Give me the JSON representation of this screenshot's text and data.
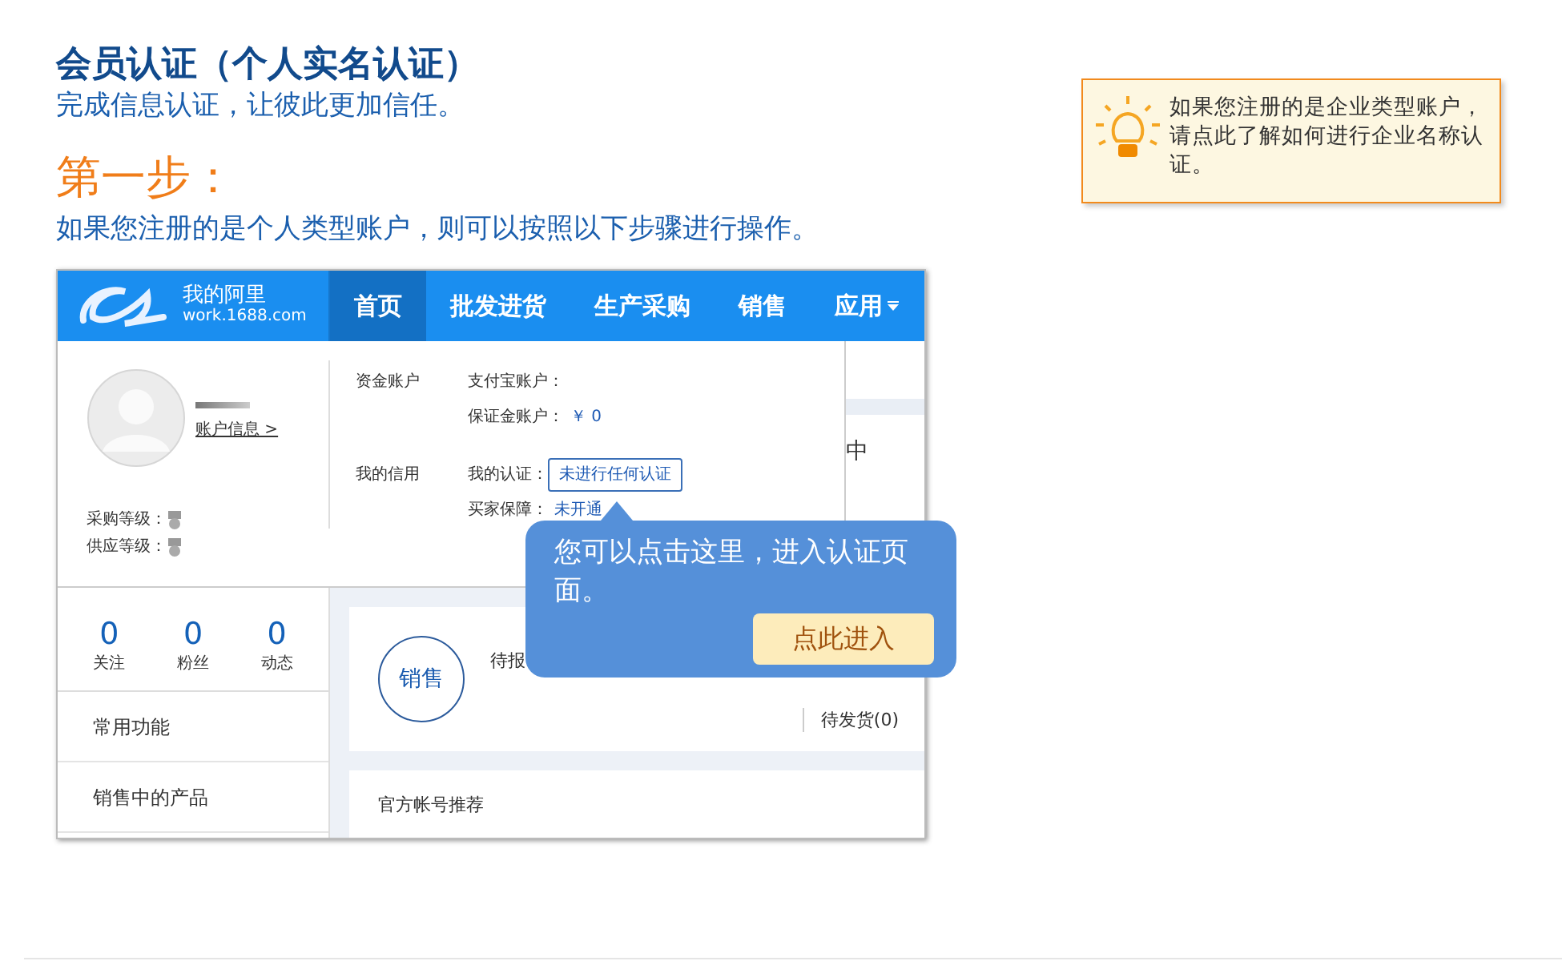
{
  "header": {
    "title": "会员认证（个人实名认证）",
    "subtitle": "完成信息认证，让彼此更加信任。"
  },
  "tip": {
    "text": "如果您注册的是企业类型账户，请点此了解如何进行企业名称认证。"
  },
  "step": {
    "heading": "第一步：",
    "text": "如果您注册的是个人类型账户，则可以按照以下步骤进行操作。"
  },
  "screenshot": {
    "brand": {
      "name": "我的阿里",
      "site": "work.1688.com"
    },
    "nav": [
      {
        "label": "首页",
        "selected": true
      },
      {
        "label": "批发进货",
        "selected": false
      },
      {
        "label": "生产采购",
        "selected": false
      },
      {
        "label": "销售",
        "selected": false
      },
      {
        "label": "应用",
        "selected": false,
        "dropdown": true
      }
    ],
    "profile": {
      "account_link": "账户信息 >",
      "levels": [
        {
          "label": "采购等级："
        },
        {
          "label": "供应等级："
        }
      ]
    },
    "sections": [
      {
        "title": "资金账户",
        "rows": [
          {
            "label": "支付宝账户："
          },
          {
            "label": "保证金账户：",
            "value": "￥ 0"
          }
        ]
      },
      {
        "title": "我的信用",
        "rows": [
          {
            "label": "我的认证：",
            "value": "未进行任何认证",
            "highlighted": true
          },
          {
            "label": "买家保障：",
            "value": "未开通"
          }
        ]
      }
    ],
    "side_text": "中",
    "stats": [
      {
        "value": "0",
        "label": "关注"
      },
      {
        "value": "0",
        "label": "粉丝"
      },
      {
        "value": "0",
        "label": "动态"
      }
    ],
    "menu": [
      {
        "label": "常用功能"
      },
      {
        "label": "销售中的产品"
      }
    ],
    "sales": {
      "badge": "销售",
      "pending": "待报",
      "shipping": "待发货(0)"
    },
    "recommend": {
      "title": "官方帐号推荐"
    },
    "callout": {
      "text": "您可以点击这里，进入认证页面。",
      "button": "点此进入"
    }
  }
}
